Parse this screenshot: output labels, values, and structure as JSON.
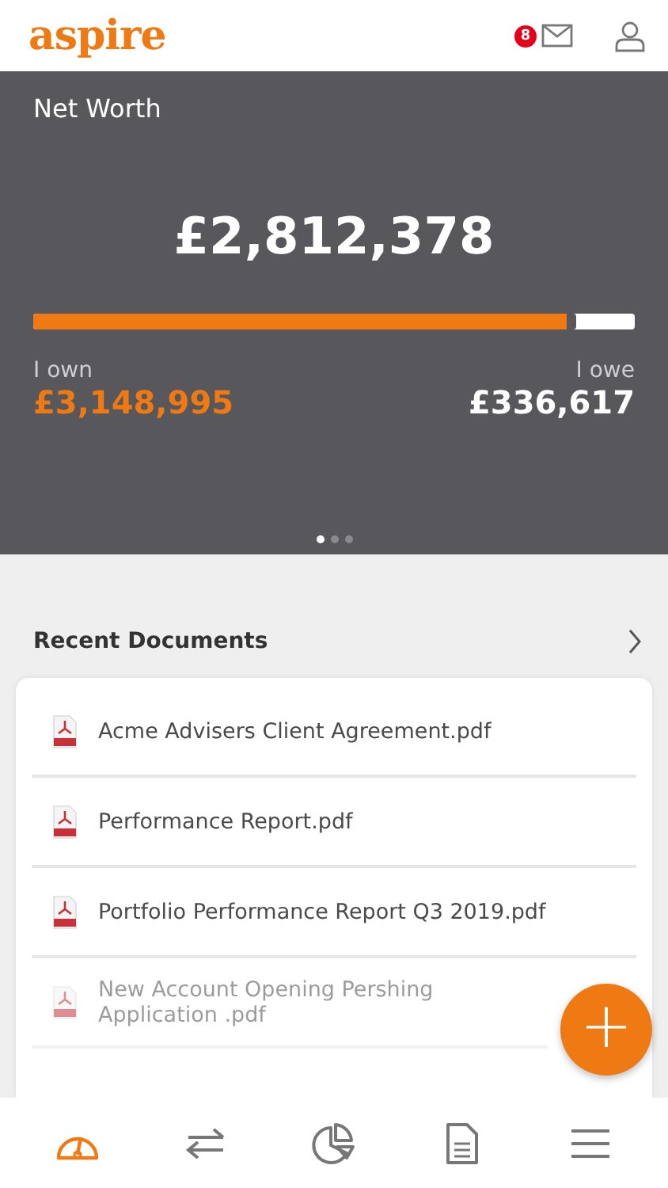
{
  "header": {
    "logo": "aspire",
    "message_count": "8"
  },
  "net_worth": {
    "title": "Net Worth",
    "total": "£2,812,378",
    "level": 0.903,
    "own_label": "I own",
    "own_value": "£3,148,995",
    "owe_label": "I owe",
    "owe_value": "£336,617",
    "pages": [
      {
        "selected": true
      },
      {
        "selected": false
      },
      {
        "selected": false
      }
    ]
  },
  "recent_documents": {
    "title": "Recent Documents",
    "items": [
      {
        "name": "Acme Advisers Client Agreement.pdf",
        "dimmed": false
      },
      {
        "name": "Performance Report.pdf",
        "dimmed": false
      },
      {
        "name": "Portfolio Performance Report Q3 2019.pdf",
        "dimmed": false
      },
      {
        "name": "New Account Opening Pershing Application .pdf",
        "dimmed": true
      }
    ]
  },
  "fab": "+",
  "nav": [
    {
      "kind": "dashboard",
      "selected": true
    },
    {
      "kind": "transfers",
      "selected": false
    },
    {
      "kind": "portfolio",
      "selected": false
    },
    {
      "kind": "documents",
      "selected": false
    },
    {
      "kind": "menu",
      "selected": false
    }
  ]
}
